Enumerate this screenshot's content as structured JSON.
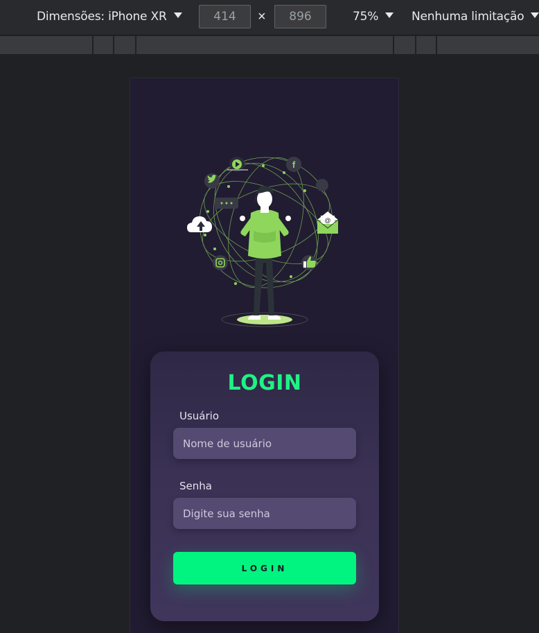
{
  "toolbar": {
    "dimensions_label": "Dimensões: iPhone XR",
    "width_value": "414",
    "times_symbol": "×",
    "height_value": "896",
    "zoom_label": "75%",
    "throttle_label": "Nenhuma limitação"
  },
  "login": {
    "title": "LOGIN",
    "username_label": "Usuário",
    "username_placeholder": "Nome de usuário",
    "password_label": "Senha",
    "password_placeholder": "Digite sua senha",
    "submit_label": "LOGIN"
  },
  "illustration": {
    "icons": [
      "play-icon",
      "facebook-icon",
      "twitter-icon",
      "chat-icon",
      "cloud-upload-icon",
      "email-icon",
      "instagram-icon",
      "thumbs-up-icon"
    ]
  },
  "colors": {
    "accent": "#00f47f",
    "title": "#1ff285",
    "page_bg": "#211c32",
    "card_bg": "#3a3154",
    "input_bg": "#544a72",
    "illustration_green": "#8fd65c"
  }
}
